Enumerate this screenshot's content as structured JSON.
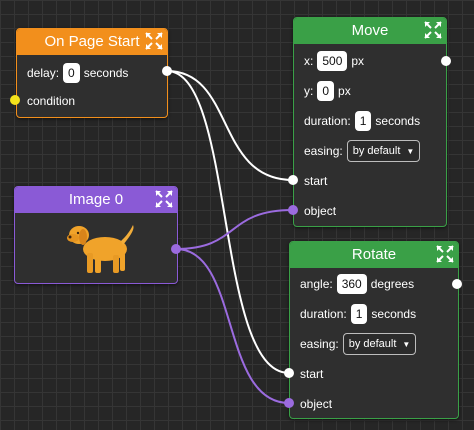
{
  "colors": {
    "orange": "#f28f1c",
    "green": "#3aa047",
    "purple": "#8a5ad6",
    "wire_white": "#ffffff",
    "wire_purple": "#9b6bdf"
  },
  "icons": [
    "move-icon",
    "dog-image"
  ],
  "nodes": {
    "page_start": {
      "title": "On Page Start",
      "delay_label": "delay:",
      "delay_value": "0",
      "delay_unit": "seconds",
      "condition_label": "condition"
    },
    "image": {
      "title": "Image 0"
    },
    "move": {
      "title": "Move",
      "x_label": "x:",
      "x_value": "500",
      "x_unit": "px",
      "y_label": "y:",
      "y_value": "0",
      "y_unit": "px",
      "duration_label": "duration:",
      "duration_value": "1",
      "duration_unit": "seconds",
      "easing_label": "easing:",
      "easing_value": "by default",
      "start_label": "start",
      "object_label": "object"
    },
    "rotate": {
      "title": "Rotate",
      "angle_label": "angle:",
      "angle_value": "360",
      "angle_unit": "degrees",
      "duration_label": "duration:",
      "duration_value": "1",
      "duration_unit": "seconds",
      "easing_label": "easing:",
      "easing_value": "by default",
      "start_label": "start",
      "object_label": "object"
    }
  }
}
